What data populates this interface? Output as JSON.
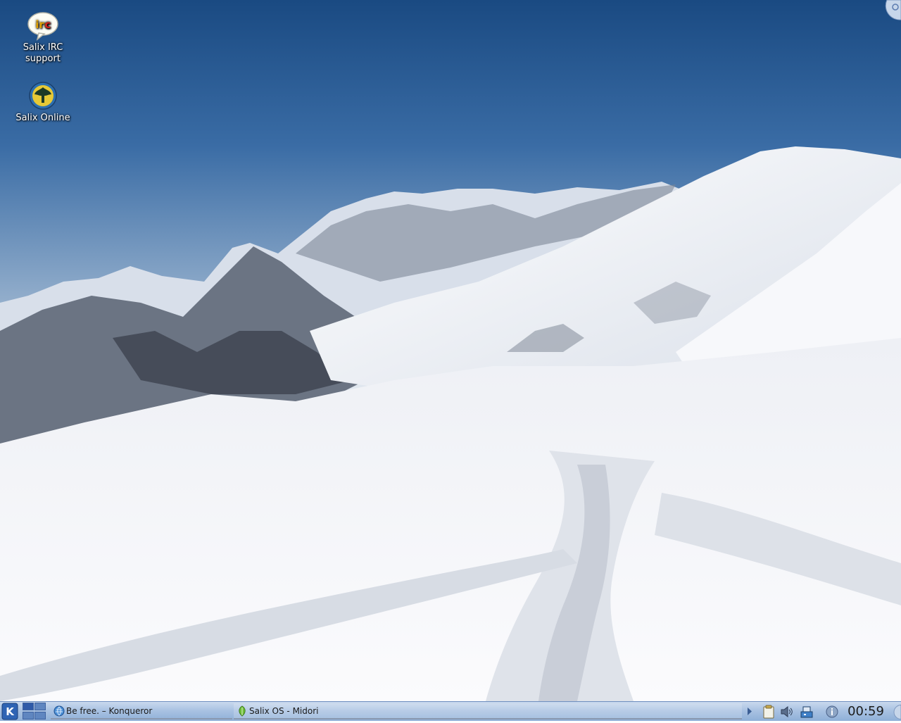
{
  "desktop": {
    "icons": [
      {
        "label": "Salix IRC support",
        "icon": "irc-icon"
      },
      {
        "label": "Salix Online",
        "icon": "salix-globe-icon"
      }
    ]
  },
  "taskbar": {
    "start_icon": "kde-logo-icon",
    "tasks": [
      {
        "label": "Be free. – Konqueror",
        "icon": "konqueror-icon"
      },
      {
        "label": "Salix OS - Midori",
        "icon": "midori-icon"
      }
    ],
    "tray_icons": [
      "clipboard-icon",
      "volume-icon",
      "network-icon",
      "info-icon"
    ],
    "clock": "00:59"
  },
  "colors": {
    "taskbar": "#a9c2e2",
    "sky": "#2a5f98",
    "snow": "#f4f5f8"
  }
}
